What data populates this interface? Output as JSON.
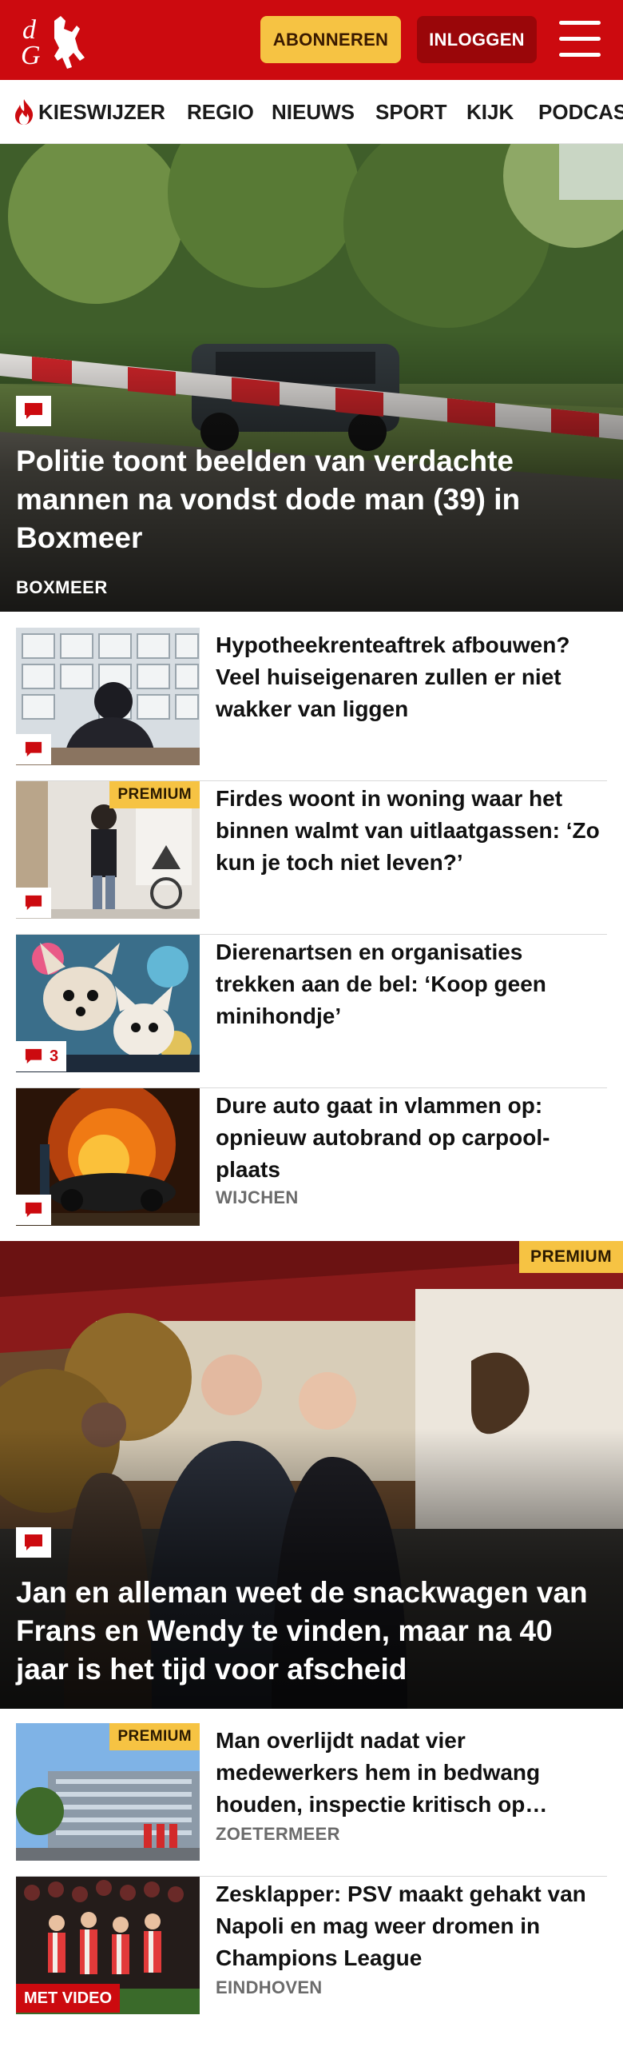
{
  "header": {
    "subscribe_label": "ABONNEREN",
    "login_label": "INLOGGEN",
    "brand_color": "#cc0a0f",
    "subscribe_color": "#f6c343"
  },
  "nav": {
    "items": [
      {
        "label": "KIESWIJZER",
        "icon": "flame-icon"
      },
      {
        "label": "REGIO"
      },
      {
        "label": "NIEUWS"
      },
      {
        "label": "SPORT"
      },
      {
        "label": "KIJK"
      },
      {
        "label": "PODCAS"
      }
    ]
  },
  "hero": {
    "title": "Politie toont beelden van verdachte mannen na vondst dode man (39) in Boxmeer",
    "kicker": "BOXMEER"
  },
  "articles": [
    {
      "title": "Hypotheekrenteaftrek afbouwen? Veel huiseigenaren zullen er niet wakker van liggen",
      "location": "",
      "premium": "",
      "comments": ""
    },
    {
      "title": "Firdes woont in woning waar het binnen walmt van uitlaatgassen: ‘Zo kun je toch niet leven?’",
      "location": "",
      "premium": "PREMIUM",
      "comments": ""
    },
    {
      "title": "Dierenartsen en organisaties trekken aan de bel: ‘Koop geen minihondje’",
      "location": "",
      "premium": "",
      "comments": "3"
    },
    {
      "title": "Dure auto gaat in vlammen op: opnieuw autobrand op carpool-plaats",
      "location": "WIJCHEN",
      "premium": "",
      "comments": ""
    }
  ],
  "big_story": {
    "title": "Jan en alleman weet de snackwagen van Frans en Wendy te vinden, maar na 40 jaar is het tijd voor afscheid",
    "premium": "PREMIUM"
  },
  "more_articles": [
    {
      "title": "Man overlijdt nadat vier medewerkers hem in bedwang houden, inspectie kritisch op…",
      "location": "ZOETERMEER",
      "premium": "PREMIUM"
    },
    {
      "title": "Zesklapper: PSV maakt gehakt van Napoli en mag weer dromen in Champions League",
      "location": "EINDHOVEN",
      "video": "MET VIDEO"
    }
  ]
}
